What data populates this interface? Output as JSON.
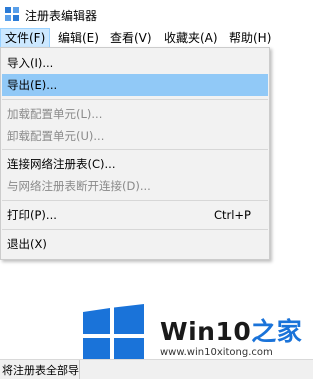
{
  "window": {
    "title": "注册表编辑器"
  },
  "menubar": {
    "items": [
      {
        "label": "文件(F)"
      },
      {
        "label": "编辑(E)"
      },
      {
        "label": "查看(V)"
      },
      {
        "label": "收藏夹(A)"
      },
      {
        "label": "帮助(H)"
      }
    ]
  },
  "file_menu": {
    "items": [
      {
        "label": "导入(I)...",
        "state": "enabled"
      },
      {
        "label": "导出(E)...",
        "state": "highlighted"
      },
      {
        "label": "加载配置单元(L)...",
        "state": "disabled"
      },
      {
        "label": "卸载配置单元(U)...",
        "state": "disabled"
      },
      {
        "label": "连接网络注册表(C)...",
        "state": "enabled"
      },
      {
        "label": "与网络注册表断开连接(D)...",
        "state": "disabled"
      },
      {
        "label": "打印(P)...",
        "state": "enabled",
        "shortcut": "Ctrl+P"
      },
      {
        "label": "退出(X)",
        "state": "enabled"
      }
    ]
  },
  "watermark": {
    "brand_prefix": "Win10",
    "brand_suffix": "之家",
    "url": "www.win10xitong.com"
  },
  "statusbar": {
    "text": "将注册表全部导"
  },
  "colors": {
    "menu_highlight": "#91c9f7",
    "menubar_active": "#cce8ff",
    "windows_blue": "#1a73d9"
  }
}
